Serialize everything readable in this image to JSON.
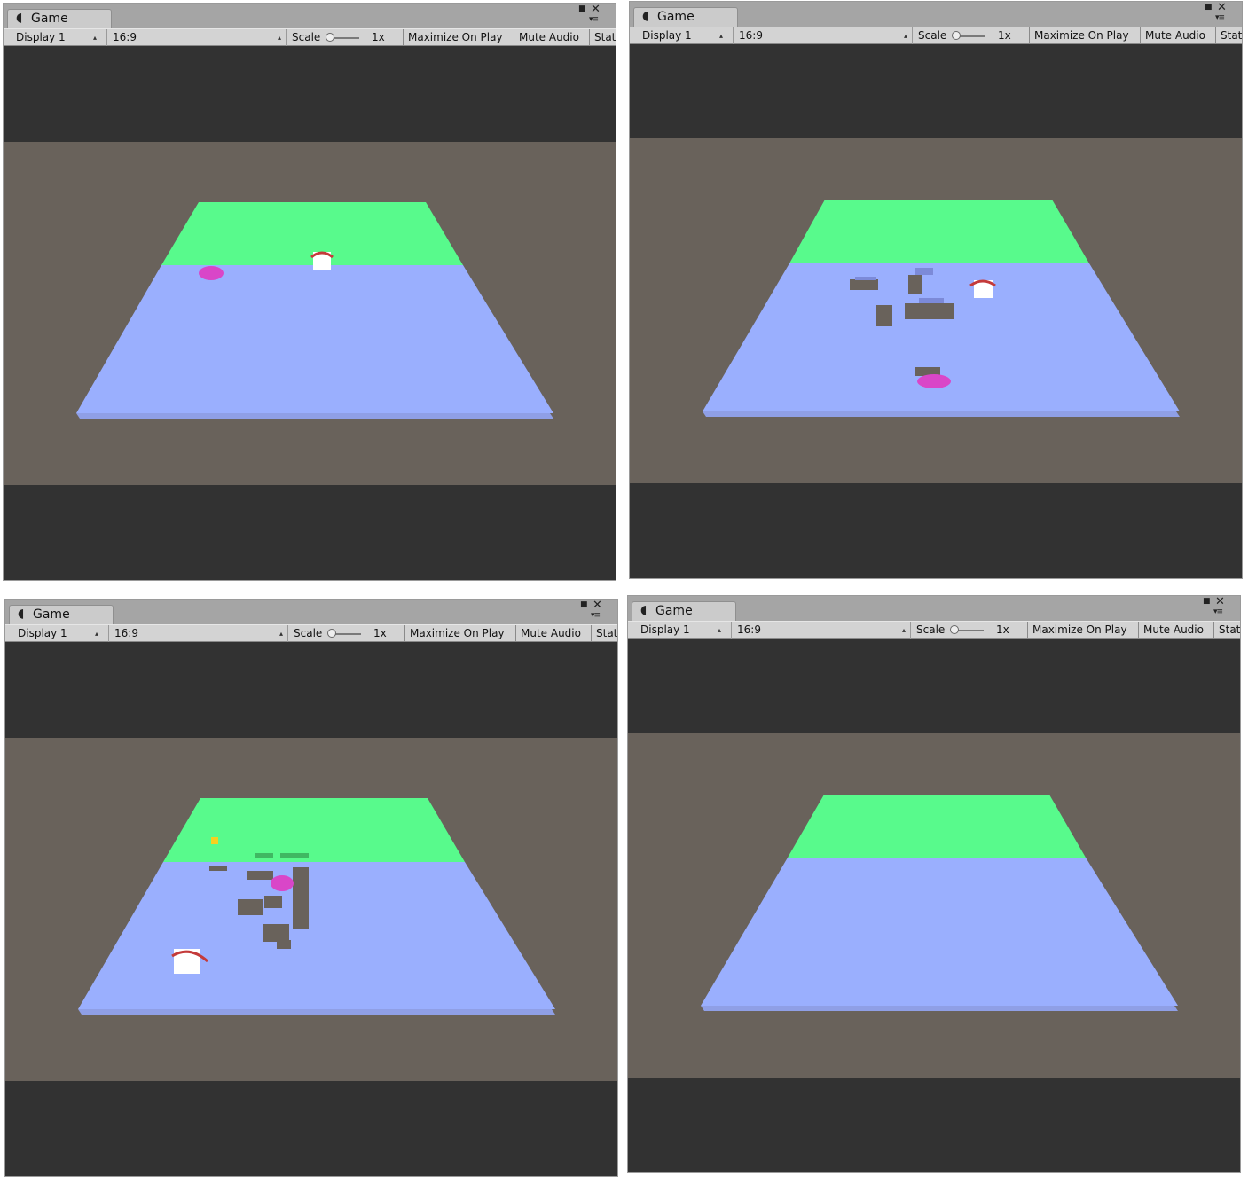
{
  "panels": [
    {
      "tab": {
        "label": "Game",
        "icon": "pacman-icon"
      },
      "toolbar": {
        "display": "Display 1",
        "aspect": "16:9",
        "scale_label": "Scale",
        "scale_value": "1x",
        "maximize_on_play": "Maximize On Play",
        "mute_audio": "Mute Audio",
        "stats": "Stat"
      },
      "scene": {
        "sky_color": "#323232",
        "ground_color": "#69625b",
        "goal_zone_color": "#58fa8c",
        "field_color": "#9aaffe",
        "objects": [
          "pink-disc",
          "white-cube"
        ]
      }
    },
    {
      "tab": {
        "label": "Game",
        "icon": "pacman-icon"
      },
      "toolbar": {
        "display": "Display 1",
        "aspect": "16:9",
        "scale_label": "Scale",
        "scale_value": "1x",
        "maximize_on_play": "Maximize On Play",
        "mute_audio": "Mute Audio",
        "stats": "Stat"
      },
      "scene": {
        "sky_color": "#323232",
        "ground_color": "#69625b",
        "goal_zone_color": "#58fa8c",
        "field_color": "#9aaffe",
        "objects": [
          "floor-holes",
          "white-cube",
          "pink-disc"
        ]
      }
    },
    {
      "tab": {
        "label": "Game",
        "icon": "pacman-icon"
      },
      "toolbar": {
        "display": "Display 1",
        "aspect": "16:9",
        "scale_label": "Scale",
        "scale_value": "1x",
        "maximize_on_play": "Maximize On Play",
        "mute_audio": "Mute Audio",
        "stats": "Stat"
      },
      "scene": {
        "sky_color": "#323232",
        "ground_color": "#69625b",
        "goal_zone_color": "#58fa8c",
        "field_color": "#9aaffe",
        "objects": [
          "floor-holes",
          "pink-disc",
          "green-blocks",
          "yellow-cube",
          "white-cube"
        ]
      }
    },
    {
      "tab": {
        "label": "Game",
        "icon": "pacman-icon"
      },
      "toolbar": {
        "display": "Display 1",
        "aspect": "16:9",
        "scale_label": "Scale",
        "scale_value": "1x",
        "maximize_on_play": "Maximize On Play",
        "mute_audio": "Mute Audio",
        "stats": "Stat"
      },
      "scene": {
        "sky_color": "#323232",
        "ground_color": "#69625b",
        "goal_zone_color": "#58fa8c",
        "field_color": "#9aaffe",
        "objects": []
      }
    }
  ]
}
